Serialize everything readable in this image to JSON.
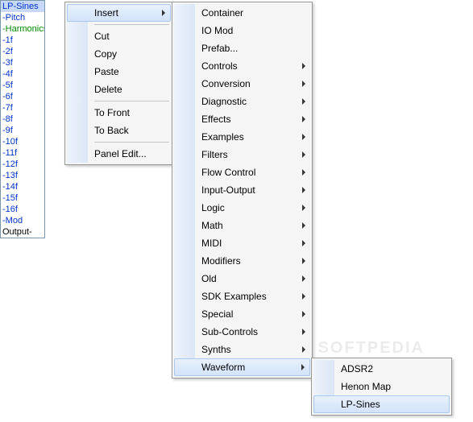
{
  "sidebar": {
    "items": [
      {
        "label": "LP-Sines",
        "cls": "blue selected"
      },
      {
        "label": "-Pitch",
        "cls": "blue"
      },
      {
        "label": "-Harmonics",
        "cls": "green"
      },
      {
        "label": "-1f",
        "cls": "blue"
      },
      {
        "label": "-2f",
        "cls": "blue"
      },
      {
        "label": "-3f",
        "cls": "blue"
      },
      {
        "label": "-4f",
        "cls": "blue"
      },
      {
        "label": "-5f",
        "cls": "blue"
      },
      {
        "label": "-6f",
        "cls": "blue"
      },
      {
        "label": "-7f",
        "cls": "blue"
      },
      {
        "label": "-8f",
        "cls": "blue"
      },
      {
        "label": "-9f",
        "cls": "blue"
      },
      {
        "label": "-10f",
        "cls": "blue"
      },
      {
        "label": "-11f",
        "cls": "blue"
      },
      {
        "label": "-12f",
        "cls": "blue"
      },
      {
        "label": "-13f",
        "cls": "blue"
      },
      {
        "label": "-14f",
        "cls": "blue"
      },
      {
        "label": "-15f",
        "cls": "blue"
      },
      {
        "label": "-16f",
        "cls": "blue"
      },
      {
        "label": "-Mod",
        "cls": "blue"
      },
      {
        "label": "Output-",
        "cls": ""
      }
    ]
  },
  "menu1": {
    "groups": [
      [
        {
          "label": "Insert",
          "arrow": true,
          "highlight": true
        }
      ],
      [
        {
          "label": "Cut"
        },
        {
          "label": "Copy"
        },
        {
          "label": "Paste"
        },
        {
          "label": "Delete"
        }
      ],
      [
        {
          "label": "To Front"
        },
        {
          "label": "To Back"
        }
      ],
      [
        {
          "label": "Panel Edit..."
        }
      ]
    ]
  },
  "menu2": {
    "items": [
      {
        "label": "Container"
      },
      {
        "label": "IO Mod"
      },
      {
        "label": "Prefab..."
      },
      {
        "label": "Controls",
        "arrow": true
      },
      {
        "label": "Conversion",
        "arrow": true
      },
      {
        "label": "Diagnostic",
        "arrow": true
      },
      {
        "label": "Effects",
        "arrow": true
      },
      {
        "label": "Examples",
        "arrow": true
      },
      {
        "label": "Filters",
        "arrow": true
      },
      {
        "label": "Flow Control",
        "arrow": true
      },
      {
        "label": "Input-Output",
        "arrow": true
      },
      {
        "label": "Logic",
        "arrow": true
      },
      {
        "label": "Math",
        "arrow": true
      },
      {
        "label": "MIDI",
        "arrow": true
      },
      {
        "label": "Modifiers",
        "arrow": true
      },
      {
        "label": "Old",
        "arrow": true
      },
      {
        "label": "SDK Examples",
        "arrow": true
      },
      {
        "label": "Special",
        "arrow": true
      },
      {
        "label": "Sub-Controls",
        "arrow": true
      },
      {
        "label": "Synths",
        "arrow": true
      },
      {
        "label": "Waveform",
        "arrow": true,
        "highlight": true
      }
    ]
  },
  "menu3": {
    "items": [
      {
        "label": "ADSR2"
      },
      {
        "label": "Henon Map"
      },
      {
        "label": "LP-Sines",
        "highlight": true
      }
    ]
  },
  "watermark": "SOFTPEDIA"
}
